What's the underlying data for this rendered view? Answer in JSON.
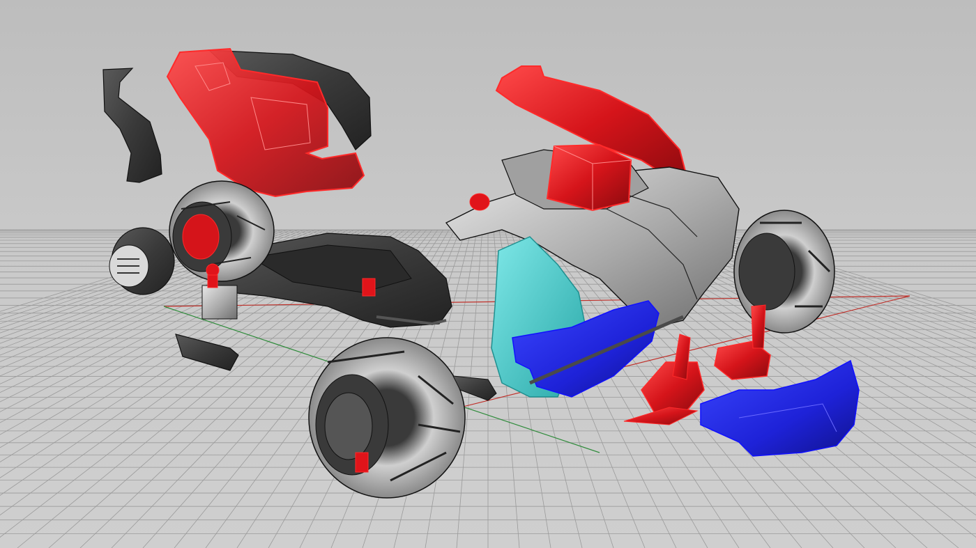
{
  "viewport": {
    "kind": "3D CAD perspective viewport",
    "background_color": "#c8c8c8",
    "grid": {
      "visible": true,
      "color": "#9a9a9a",
      "major_color": "#8e8e8e"
    },
    "axes": {
      "x_axis_color": "#c0302a",
      "y_axis_color": "#2e8b3a"
    }
  },
  "selection_colors": {
    "selected_red": "#e0141a",
    "selected_blue": "#1e22d8",
    "selected_cyan": "#39c9c9",
    "unselected_dark": "#3b3b3b",
    "unselected_light": "#a9a9a9",
    "edge_highlight": "#ff2a2a"
  },
  "parts": [
    {
      "name": "seat-shell",
      "state": "selected",
      "color": "red"
    },
    {
      "name": "seat-back-cushion",
      "state": "unselected",
      "color": "dark"
    },
    {
      "name": "side-bracket",
      "state": "unselected",
      "color": "dark"
    },
    {
      "name": "chassis-frame",
      "state": "unselected",
      "color": "dark"
    },
    {
      "name": "rear-wheel-left",
      "state": "unselected",
      "color": "light"
    },
    {
      "name": "rear-hub-cap",
      "state": "unselected",
      "color": "dark"
    },
    {
      "name": "front-wheel",
      "state": "unselected",
      "color": "light"
    },
    {
      "name": "front-wheel-right",
      "state": "unselected",
      "color": "light"
    },
    {
      "name": "body-fairing",
      "state": "unselected",
      "color": "light"
    },
    {
      "name": "top-spoiler",
      "state": "selected",
      "color": "red"
    },
    {
      "name": "battery-box",
      "state": "selected",
      "color": "red"
    },
    {
      "name": "inner-panel",
      "state": "selected",
      "color": "cyan"
    },
    {
      "name": "steering-bracket",
      "state": "selected",
      "color": "blue"
    },
    {
      "name": "front-bumper",
      "state": "selected",
      "color": "blue"
    },
    {
      "name": "suspension-spring-left",
      "state": "selected",
      "color": "red"
    },
    {
      "name": "suspension-spring-right",
      "state": "selected",
      "color": "red"
    },
    {
      "name": "foot-pedal",
      "state": "unselected",
      "color": "dark"
    },
    {
      "name": "steering-arm",
      "state": "unselected",
      "color": "dark"
    }
  ]
}
